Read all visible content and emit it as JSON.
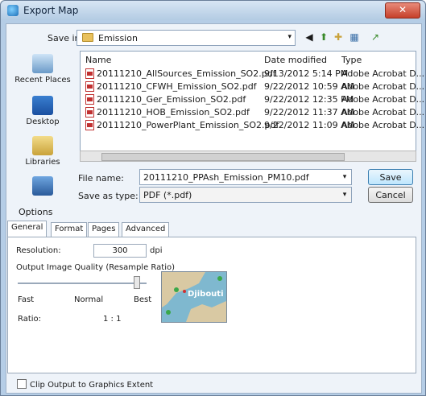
{
  "window": {
    "title": "Export Map",
    "close_glyph": "✕"
  },
  "save_in": {
    "label": "Save in:",
    "value": "Emission",
    "arrow": "▾"
  },
  "toolbar": [
    {
      "name": "back-icon",
      "glyph": "◀"
    },
    {
      "name": "up-folder-icon",
      "glyph": "⬆"
    },
    {
      "name": "new-folder-icon",
      "glyph": "✚"
    },
    {
      "name": "view-menu-icon",
      "glyph": "▦"
    },
    {
      "name": "connect-folder-icon",
      "glyph": "↗"
    }
  ],
  "places": [
    {
      "label": "Recent Places"
    },
    {
      "label": "Desktop"
    },
    {
      "label": "Libraries"
    },
    {
      "label": ""
    }
  ],
  "file_list": {
    "columns": [
      "Name",
      "Date modified",
      "Type"
    ],
    "rows": [
      {
        "name": "20111210_AllSources_Emission_SO2.pdf",
        "date": "9/13/2012 5:14 PM",
        "type": "Adobe Acrobat D..."
      },
      {
        "name": "20111210_CFWH_Emission_SO2.pdf",
        "date": "9/22/2012 10:59 AM",
        "type": "Adobe Acrobat D..."
      },
      {
        "name": "20111210_Ger_Emission_SO2.pdf",
        "date": "9/22/2012 12:35 PM",
        "type": "Adobe Acrobat D..."
      },
      {
        "name": "20111210_HOB_Emission_SO2.pdf",
        "date": "9/22/2012 11:37 AM",
        "type": "Adobe Acrobat D..."
      },
      {
        "name": "20111210_PowerPlant_Emission_SO2.pdf",
        "date": "9/22/2012 11:09 AM",
        "type": "Adobe Acrobat D..."
      }
    ]
  },
  "file_name": {
    "label": "File name:",
    "value": "20111210_PPAsh_Emission_PM10.pdf",
    "arrow": "▾"
  },
  "save_as_type": {
    "label": "Save as type:",
    "value": "PDF (*.pdf)",
    "arrow": "▾"
  },
  "buttons": {
    "save": "Save",
    "cancel": "Cancel"
  },
  "options": {
    "label": "Options",
    "tabs": [
      "General",
      "Format",
      "Pages",
      "Advanced"
    ],
    "resolution_label": "Resolution:",
    "resolution_value": "300",
    "resolution_unit": "dpi",
    "quality_label": "Output Image Quality (Resample Ratio)",
    "quality_fast": "Fast",
    "quality_normal": "Normal",
    "quality_best": "Best",
    "ratio_label": "Ratio:",
    "ratio_value": "1 : 1",
    "preview_label": "Djibouti"
  },
  "clip_output": {
    "label": "Clip Output to Graphics Extent",
    "checked": false
  },
  "colors": {
    "title_bar": "#b3cbe3",
    "save_button": "#bee6fd",
    "pdf_icon": "#c03030"
  }
}
